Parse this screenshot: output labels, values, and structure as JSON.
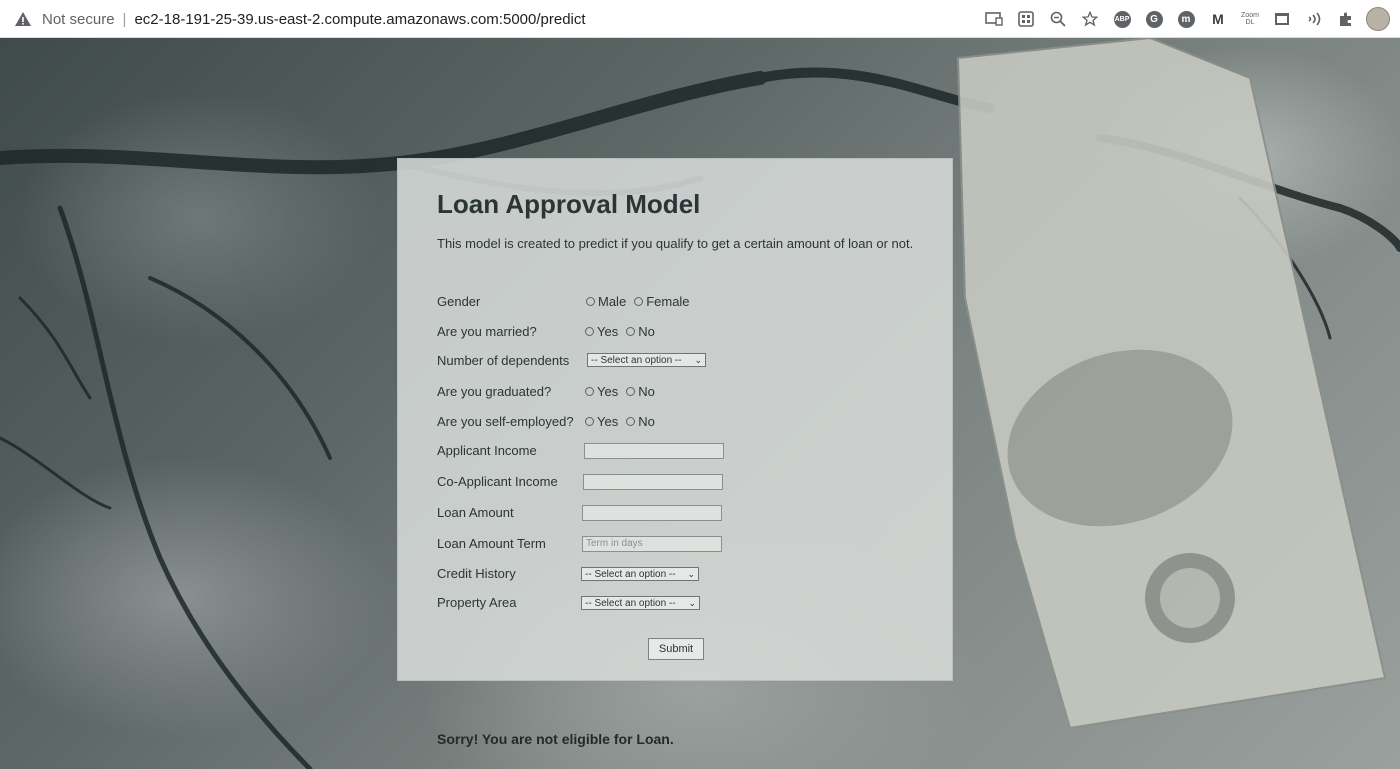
{
  "browser": {
    "security_label": "Not secure",
    "separator": "|",
    "url": "ec2-18-191-25-39.us-east-2.compute.amazonaws.com:5000/predict",
    "toolbar_icons": [
      "cast-icon",
      "qr-code-icon",
      "zoom-icon",
      "star-icon",
      "adblock-plus-icon",
      "grammarly-icon",
      "m-circle-icon",
      "m-extension-icon",
      "zoom-dl-icon",
      "screenshot-icon",
      "read-aloud-icon",
      "extensions-puzzle-icon",
      "profile-avatar"
    ],
    "abp_label": "ABP",
    "g_label": "G",
    "m_circle_label": "m",
    "m_label": "M",
    "zoom_dl_label_top": "Zoom",
    "zoom_dl_label_bottom": "DL"
  },
  "form": {
    "title": "Loan Approval Model",
    "description": "This model is created to predict if you qualify to get a certain amount of loan or not.",
    "gender": {
      "label": "Gender",
      "options": [
        "Male",
        "Female"
      ]
    },
    "married": {
      "label": "Are you married?",
      "options": [
        "Yes",
        "No"
      ]
    },
    "dependents": {
      "label": "Number of dependents",
      "selected": "-- Select an option --"
    },
    "graduated": {
      "label": "Are you graduated?",
      "options": [
        "Yes",
        "No"
      ]
    },
    "self_employed": {
      "label": "Are you self-employed?",
      "options": [
        "Yes",
        "No"
      ]
    },
    "applicant_income": {
      "label": "Applicant Income",
      "value": ""
    },
    "coapplicant_income": {
      "label": "Co-Applicant Income",
      "value": ""
    },
    "loan_amount": {
      "label": "Loan Amount",
      "value": ""
    },
    "loan_amount_term": {
      "label": "Loan Amount Term",
      "placeholder": "Term in days"
    },
    "credit_history": {
      "label": "Credit History",
      "selected": "-- Select an option --"
    },
    "property_area": {
      "label": "Property Area",
      "selected": "-- Select an option --"
    },
    "submit_label": "Submit"
  },
  "result": "Sorry! You are not eligible for Loan."
}
